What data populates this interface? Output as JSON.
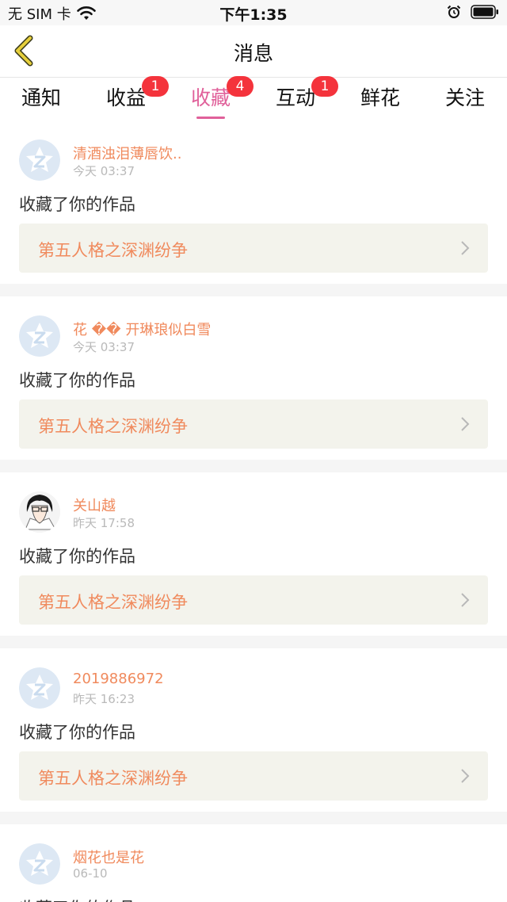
{
  "status_bar": {
    "carrier": "无 SIM 卡",
    "time": "下午1:35",
    "icons": [
      "wifi-icon",
      "alarm-icon",
      "battery-icon"
    ]
  },
  "nav": {
    "title": "消息",
    "back_icon": "chevron-left-icon"
  },
  "tabs": [
    {
      "label": "通知",
      "badge": null
    },
    {
      "label": "收益",
      "badge": "1"
    },
    {
      "label": "收藏",
      "badge": "4"
    },
    {
      "label": "互动",
      "badge": "1"
    },
    {
      "label": "鲜花",
      "badge": null
    },
    {
      "label": "关注",
      "badge": null
    }
  ],
  "active_tab": "收藏",
  "messages": [
    {
      "user": "清酒浊泪薄唇饮..",
      "time": "今天 03:37",
      "action": "收藏了你的作品",
      "work": "第五人格之深渊纷争",
      "avatar": "default-avatar-icon"
    },
    {
      "user": "花 �� 开琳琅似白雪",
      "time": "今天 03:37",
      "action": "收藏了你的作品",
      "work": "第五人格之深渊纷争",
      "avatar": "default-avatar-icon"
    },
    {
      "user": "关山越",
      "time": "昨天 17:58",
      "action": "收藏了你的作品",
      "work": "第五人格之深渊纷争",
      "avatar": "anime-avatar"
    },
    {
      "user": "2019886972",
      "time": "昨天 16:23",
      "action": "收藏了你的作品",
      "work": "第五人格之深渊纷争",
      "avatar": "default-avatar-icon"
    },
    {
      "user": "烟花也是花",
      "time": "06-10",
      "action": "收藏了你的作品",
      "work": "",
      "avatar": "default-avatar-icon"
    }
  ],
  "colors": {
    "accent": "#e0609a",
    "name_orange": "#f08a5d",
    "badge_red": "#f4333c",
    "link_bg": "#f3f3ec",
    "back_arrow": "#d9c23a"
  }
}
